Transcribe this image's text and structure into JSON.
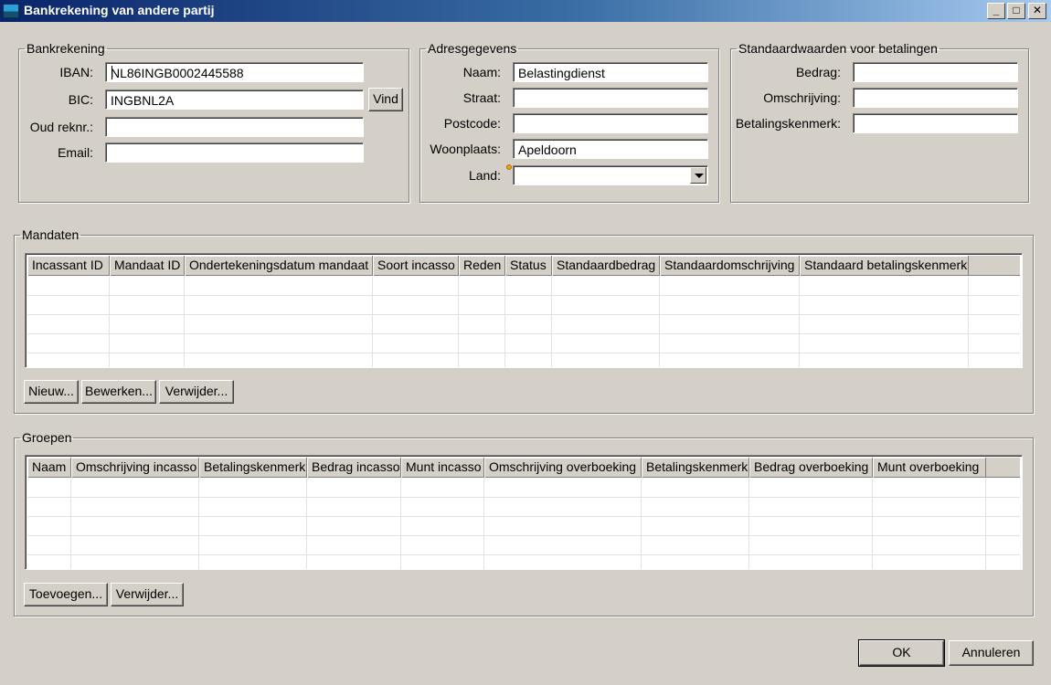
{
  "window": {
    "title": "Bankrekening van andere partij",
    "controls": {
      "minimize": "_",
      "maximize": "□",
      "close": "✕"
    }
  },
  "bankrekening": {
    "legend": "Bankrekening",
    "iban_label": "IBAN:",
    "iban_value": "NL86INGB0002445588",
    "bic_label": "BIC:",
    "bic_value": "INGBNL2A",
    "vind_button": "Vind",
    "oud_label": "Oud reknr.:",
    "oud_value": "",
    "email_label": "Email:",
    "email_value": ""
  },
  "adres": {
    "legend": "Adresgegevens",
    "naam_label": "Naam:",
    "naam_value": "Belastingdienst",
    "straat_label": "Straat:",
    "straat_value": "",
    "postcode_label": "Postcode:",
    "postcode_value": "",
    "woonplaats_label": "Woonplaats:",
    "woonplaats_value": "Apeldoorn",
    "land_label": "Land:",
    "land_value": ""
  },
  "standaard": {
    "legend": "Standaardwaarden voor betalingen",
    "bedrag_label": "Bedrag:",
    "bedrag_value": "",
    "omschrijving_label": "Omschrijving:",
    "omschrijving_value": "",
    "kenmerk_label": "Betalingskenmerk:",
    "kenmerk_value": ""
  },
  "mandaten": {
    "legend": "Mandaten",
    "columns": [
      "Incassant ID",
      "Mandaat ID",
      "Ondertekeningsdatum mandaat",
      "Soort incasso",
      "Reden",
      "Status",
      "Standaardbedrag",
      "Standaardomschrijving",
      "Standaard betalingskenmerk"
    ],
    "buttons": {
      "nieuw": "Nieuw...",
      "bewerken": "Bewerken...",
      "verwijder": "Verwijder..."
    }
  },
  "groepen": {
    "legend": "Groepen",
    "columns": [
      "Naam",
      "Omschrijving incasso",
      "Betalingskenmerk",
      "Bedrag incasso",
      "Munt incasso",
      "Omschrijving overboeking",
      "Betalingskenmerk",
      "Bedrag overboeking",
      "Munt overboeking"
    ],
    "buttons": {
      "toevoegen": "Toevoegen...",
      "verwijder": "Verwijder..."
    }
  },
  "footer": {
    "ok": "OK",
    "annuleren": "Annuleren"
  }
}
